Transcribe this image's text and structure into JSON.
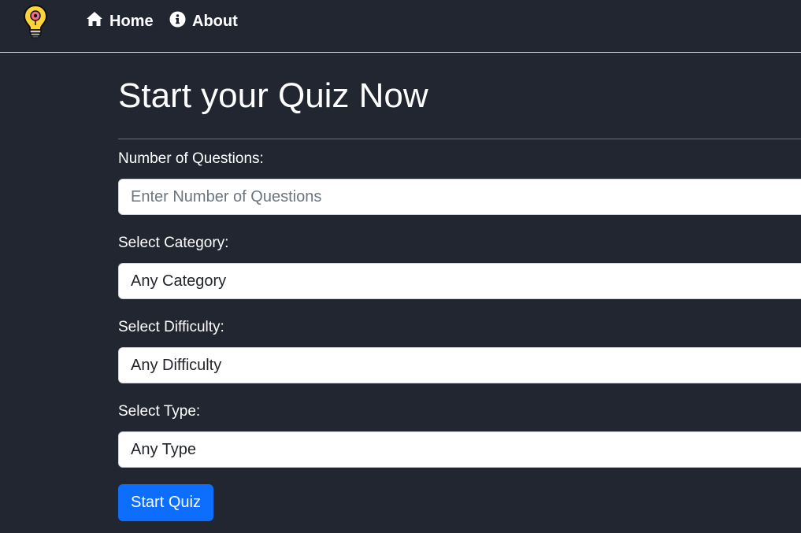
{
  "nav": {
    "logo_icon": "lightbulb-gear-icon",
    "items": [
      {
        "label": "Home",
        "icon": "home-icon"
      },
      {
        "label": "About",
        "icon": "info-circle-icon"
      }
    ]
  },
  "page": {
    "title": "Start your Quiz Now"
  },
  "form": {
    "questions": {
      "label": "Number of Questions:",
      "placeholder": "Enter Number of Questions",
      "value": ""
    },
    "category": {
      "label": "Select Category:",
      "selected": "Any Category"
    },
    "difficulty": {
      "label": "Select Difficulty:",
      "selected": "Any Difficulty"
    },
    "type": {
      "label": "Select Type:",
      "selected": "Any Type"
    },
    "submit_label": "Start Quiz"
  },
  "colors": {
    "background": "#212631",
    "accent": "#0d6efd",
    "text": "#ffffff"
  }
}
